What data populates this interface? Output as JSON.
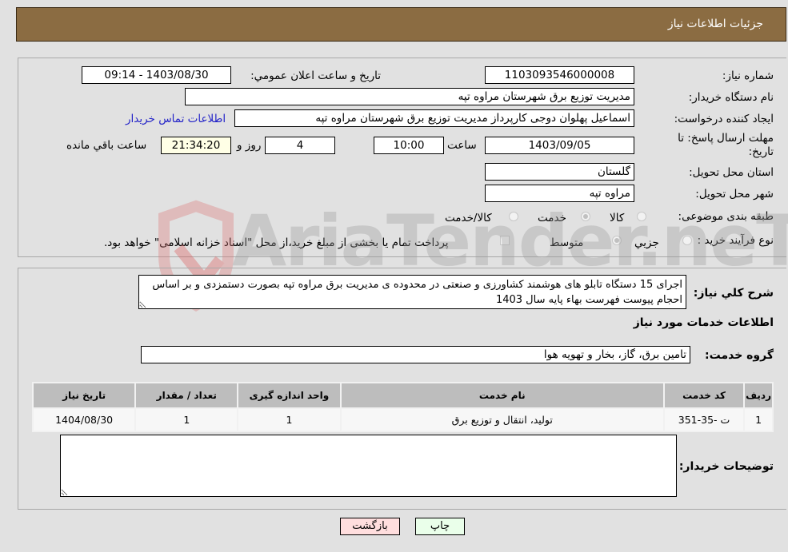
{
  "header": {
    "title": "جزئیات اطلاعات نیاز"
  },
  "fields": {
    "need_number_label": "شماره نیاز:",
    "need_number": "1103093546000008",
    "announce_label": "تاریخ و ساعت اعلان عمومي:",
    "announce_value": "1403/08/30 - 09:14",
    "buyer_org_label": "نام دستگاه خریدار:",
    "buyer_org": "مدیریت توزیع برق شهرستان مراوه تپه",
    "creator_label": "ایجاد کننده درخواست:",
    "creator": "اسماعیل پهلوان دوجی کارپرداز مدیریت توزیع برق شهرستان مراوه تپه",
    "contact_link": "اطلاعات تماس خریدار",
    "deadline_label": "مهلت ارسال پاسخ: تا تاریخ:",
    "deadline_date": "1403/09/05",
    "time_label": "ساعت",
    "deadline_time": "10:00",
    "days_value": "4",
    "days_label": "روز و",
    "remaining_time": "21:34:20",
    "remaining_label": "ساعت باقي مانده",
    "province_label": "استان محل تحویل:",
    "province": "گلستان",
    "city_label": "شهر محل تحویل:",
    "city": "مراوه تپه",
    "category_label": "طبقه بندی موضوعی:",
    "category_options": [
      "کالا",
      "خدمت",
      "کالا/خدمت"
    ],
    "category_selected": "خدمت",
    "process_label": "نوع فرآیند خرید :",
    "process_options": [
      "جزیي",
      "متوسط"
    ],
    "process_selected": "متوسط",
    "treasury_note": "پرداخت تمام یا بخشی از مبلغ خرید،از محل \"اسناد خزانه اسلامی\" خواهد بود."
  },
  "description": {
    "label": "شرح کلي نیاز:",
    "text": "اجرای 15 دستگاه تابلو های هوشمند کشاورزی و صنعتی در محدوده ی مدیریت برق مراوه تپه بصورت دستمزدی و بر اساس احجام پیوست فهرست بهاء پایه سال 1403"
  },
  "services": {
    "section_title": "اطلاعات خدمات مورد نیاز",
    "group_label": "گروه خدمت:",
    "group_value": "تامین برق، گاز، بخار و تهویه هوا",
    "table": {
      "headers": [
        "ردیف",
        "کد خدمت",
        "نام خدمت",
        "واحد اندازه گیری",
        "تعداد / مقدار",
        "تاریخ نیاز"
      ],
      "rows": [
        [
          "1",
          "ت -35-351",
          "تولید، انتقال و توزیع برق",
          "1",
          "1",
          "1404/08/30"
        ]
      ]
    }
  },
  "buyer_notes": {
    "label": "توضیحات خریدار:",
    "value": ""
  },
  "buttons": {
    "print": "چاپ",
    "back": "بازگشت"
  },
  "watermark": {
    "text": "AriaTender.neT"
  },
  "colors": {
    "header_bg": "#8b6c42",
    "print_bg": "#eaffea",
    "back_bg": "#ffdede",
    "link": "#2323c8"
  }
}
